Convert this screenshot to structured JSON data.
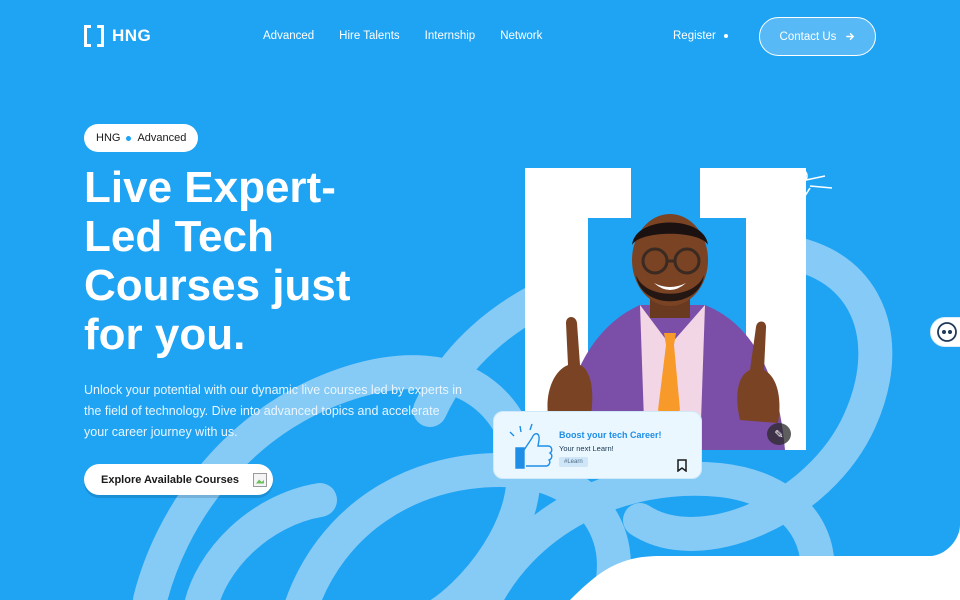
{
  "brand": {
    "name": "HNG"
  },
  "nav": {
    "items": [
      "Advanced",
      "Hire Talents",
      "Internship",
      "Network"
    ],
    "register_label": "Register",
    "contact_label": "Contact Us"
  },
  "hero": {
    "badge_brand": "HNG",
    "badge_label": "Advanced",
    "title": "Live Expert-Led Tech Courses just for you.",
    "description": "Unlock your potential with our dynamic live courses led by experts in the field of technology. Dive into advanced topics and accelerate your career journey with us.",
    "cta_label": "Explore Available Courses"
  },
  "card": {
    "title": "Boost your tech Career!",
    "subtitle": "Your next Learn!",
    "tag": "#Learn"
  },
  "colors": {
    "background": "#1fa3f3",
    "scribble": "#8ccdf7",
    "white": "#ffffff",
    "card_bg": "#eaf7ff",
    "accent_orange": "#f79a2a",
    "jacket_purple": "#7b4fa8"
  },
  "icons": {
    "logo": "bracket-logo-icon",
    "contact_arrow": "arrow-right-icon",
    "cta_image": "broken-image-icon",
    "bookmark": "bookmark-icon",
    "tool": "magic-wand-icon",
    "chat_widget": "chatbot-icon"
  }
}
